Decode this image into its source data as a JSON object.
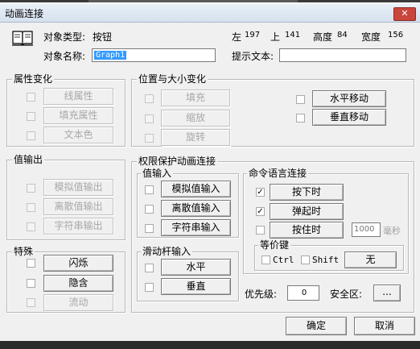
{
  "window": {
    "title": "动画连接",
    "close_glyph": "✕"
  },
  "object": {
    "type_label": "对象类型:",
    "type_value": "按钮",
    "name_label": "对象名称:",
    "name_value": "Graph1",
    "left_label": "左",
    "left_value": "197",
    "top_label": "上",
    "top_value": "141",
    "height_label": "高度",
    "height_value": "84",
    "width_label": "宽度",
    "width_value": "156",
    "hint_label": "提示文本:",
    "hint_value": ""
  },
  "attr_group": {
    "title": "属性变化",
    "items": [
      "线属性",
      "填充属性",
      "文本色"
    ]
  },
  "pos_group": {
    "title": "位置与大小变化",
    "left_items": [
      "填充",
      "缩放",
      "旋转"
    ],
    "right_items": [
      "水平移动",
      "垂直移动"
    ]
  },
  "value_out_group": {
    "title": "值输出",
    "items": [
      "模拟值输出",
      "离散值输出",
      "字符串输出"
    ]
  },
  "special_group": {
    "title": "特殊",
    "items": [
      "闪烁",
      "隐含",
      "流动"
    ]
  },
  "perm_group": {
    "title": "权限保护动画连接",
    "value_in": {
      "title": "值输入",
      "items": [
        "模拟值输入",
        "离散值输入",
        "字符串输入"
      ]
    },
    "slider_in": {
      "title": "滑动杆输入",
      "items": [
        "水平",
        "垂直"
      ]
    },
    "cmd": {
      "title": "命令语言连接",
      "items": [
        "按下时",
        "弹起时",
        "按住时"
      ],
      "checked": [
        true,
        true,
        false
      ],
      "hold_ms_value": "1000",
      "hold_ms_unit": "毫秒"
    },
    "hotkey": {
      "title": "等价键",
      "ctrl_label": "Ctrl",
      "shift_label": "Shift",
      "key_button": "无"
    },
    "priority_label": "优先级:",
    "priority_value": "0",
    "security_label": "安全区:",
    "security_button": "..."
  },
  "footer": {
    "ok_label": "确定",
    "cancel_label": "取消"
  },
  "icons": {
    "object_icon": "book-icon",
    "check_mark": "✓"
  }
}
